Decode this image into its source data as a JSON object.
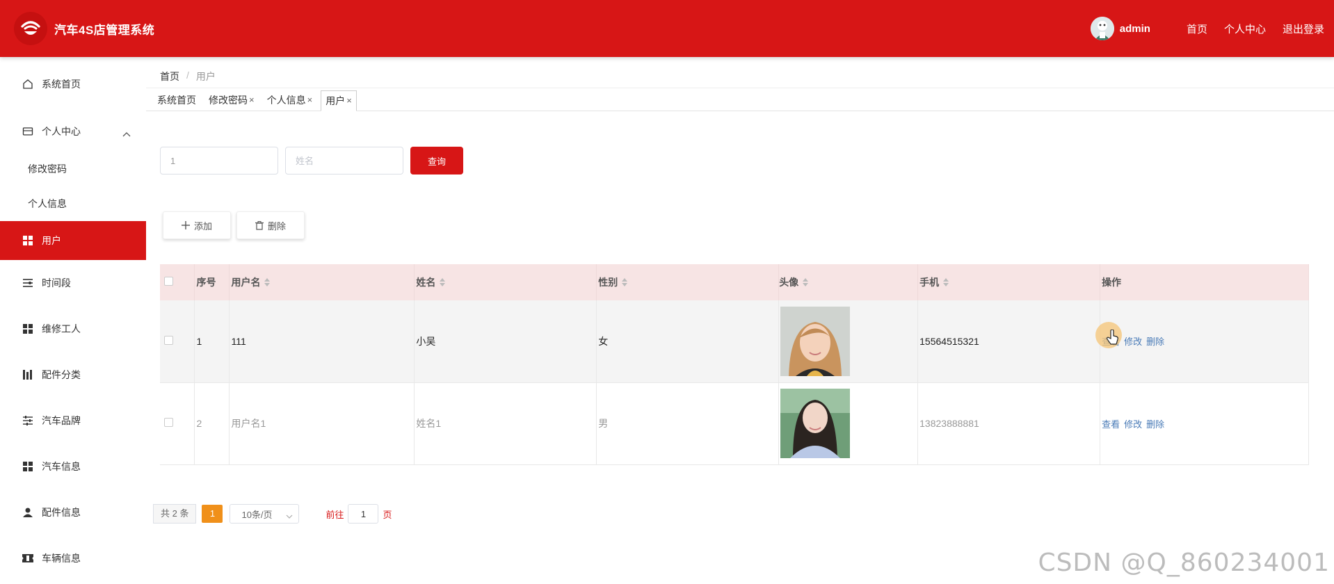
{
  "header": {
    "title": "汽车4S店管理系统",
    "username": "admin",
    "links": {
      "home": "首页",
      "profile": "个人中心",
      "logout": "退出登录"
    }
  },
  "sidebar": {
    "items": [
      {
        "label": "系统首页",
        "icon": "home-icon"
      },
      {
        "label": "个人中心",
        "icon": "card-icon"
      },
      {
        "label": "修改密码"
      },
      {
        "label": "个人信息"
      },
      {
        "label": "用户",
        "icon": "grid-icon"
      },
      {
        "label": "时间段",
        "icon": "list-icon"
      },
      {
        "label": "维修工人",
        "icon": "grid-icon"
      },
      {
        "label": "配件分类",
        "icon": "bars-icon"
      },
      {
        "label": "汽车品牌",
        "icon": "sliders-icon"
      },
      {
        "label": "汽车信息",
        "icon": "grid-icon"
      },
      {
        "label": "配件信息",
        "icon": "person-icon"
      },
      {
        "label": "车辆信息",
        "icon": "ticket-icon"
      }
    ]
  },
  "breadcrumb": {
    "home": "首页",
    "sep": "/",
    "current": "用户"
  },
  "tabs": [
    {
      "label": "系统首页"
    },
    {
      "label": "修改密码",
      "close": "×"
    },
    {
      "label": "个人信息",
      "close": "×"
    },
    {
      "label": "用户",
      "close": "×"
    }
  ],
  "search": {
    "username_value": "1",
    "name_placeholder": "姓名",
    "query_label": "查询"
  },
  "actions": {
    "add_label": "添加",
    "delete_label": "删除"
  },
  "table": {
    "headers": [
      "序号",
      "用户名",
      "姓名",
      "性别",
      "头像",
      "手机",
      "操作"
    ],
    "rows": [
      {
        "index": "1",
        "username": "111",
        "name": "小吴",
        "gender": "女",
        "phone": "15564515321"
      },
      {
        "index": "2",
        "username": "用户名1",
        "name": "姓名1",
        "gender": "男",
        "phone": "13823888881"
      }
    ],
    "ops": {
      "view": "查看",
      "edit": "修改",
      "delete": "删除"
    }
  },
  "pagination": {
    "total": "共 2 条",
    "current_page": "1",
    "page_size": "10条/页",
    "goto_prefix": "前往",
    "goto_value": "1",
    "goto_suffix": "页"
  },
  "watermark": "CSDN @Q_860234001",
  "colors": {
    "primary": "#d71616",
    "header_row": "#f7e4e4",
    "pager_active": "#f0901a",
    "link": "#4a7bb7"
  }
}
